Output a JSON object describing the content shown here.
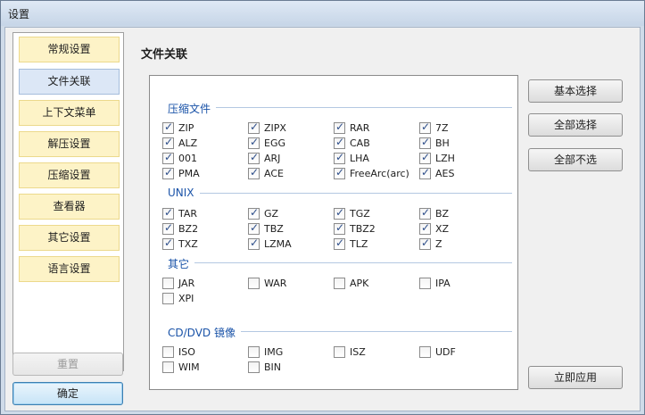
{
  "window": {
    "title": "设置"
  },
  "nav": {
    "items": [
      {
        "label": "常规设置",
        "active": false
      },
      {
        "label": "文件关联",
        "active": true
      },
      {
        "label": "上下文菜单",
        "active": false
      },
      {
        "label": "解压设置",
        "active": false
      },
      {
        "label": "压缩设置",
        "active": false
      },
      {
        "label": "查看器",
        "active": false
      },
      {
        "label": "其它设置",
        "active": false
      },
      {
        "label": "语言设置",
        "active": false
      }
    ],
    "reset_label": "重置",
    "ok_label": "确定"
  },
  "main": {
    "heading": "文件关联",
    "groups": [
      {
        "title": "压缩文件",
        "items": [
          {
            "label": "ZIP",
            "checked": true
          },
          {
            "label": "ZIPX",
            "checked": true
          },
          {
            "label": "RAR",
            "checked": true
          },
          {
            "label": "7Z",
            "checked": true
          },
          {
            "label": "ALZ",
            "checked": true
          },
          {
            "label": "EGG",
            "checked": true
          },
          {
            "label": "CAB",
            "checked": true
          },
          {
            "label": "BH",
            "checked": true
          },
          {
            "label": "001",
            "checked": true
          },
          {
            "label": "ARJ",
            "checked": true
          },
          {
            "label": "LHA",
            "checked": true
          },
          {
            "label": "LZH",
            "checked": true
          },
          {
            "label": "PMA",
            "checked": true
          },
          {
            "label": "ACE",
            "checked": true
          },
          {
            "label": "FreeArc(arc)",
            "checked": true
          },
          {
            "label": "AES",
            "checked": true
          }
        ]
      },
      {
        "title": "UNIX",
        "items": [
          {
            "label": "TAR",
            "checked": true
          },
          {
            "label": "GZ",
            "checked": true
          },
          {
            "label": "TGZ",
            "checked": true
          },
          {
            "label": "BZ",
            "checked": true
          },
          {
            "label": "BZ2",
            "checked": true
          },
          {
            "label": "TBZ",
            "checked": true
          },
          {
            "label": "TBZ2",
            "checked": true
          },
          {
            "label": "XZ",
            "checked": true
          },
          {
            "label": "TXZ",
            "checked": true
          },
          {
            "label": "LZMA",
            "checked": true
          },
          {
            "label": "TLZ",
            "checked": true
          },
          {
            "label": "Z",
            "checked": true
          }
        ]
      },
      {
        "title": "其它",
        "items": [
          {
            "label": "JAR",
            "checked": false
          },
          {
            "label": "WAR",
            "checked": false
          },
          {
            "label": "APK",
            "checked": false
          },
          {
            "label": "IPA",
            "checked": false
          },
          {
            "label": "XPI",
            "checked": false
          }
        ]
      },
      {
        "title": "CD/DVD 镜像",
        "items": [
          {
            "label": "ISO",
            "checked": false
          },
          {
            "label": "IMG",
            "checked": false
          },
          {
            "label": "ISZ",
            "checked": false
          },
          {
            "label": "UDF",
            "checked": false
          },
          {
            "label": "WIM",
            "checked": false
          },
          {
            "label": "BIN",
            "checked": false
          }
        ]
      }
    ]
  },
  "actions": {
    "basic_select": "基本选择",
    "select_all": "全部选择",
    "select_none": "全部不选",
    "apply_now": "立即应用"
  }
}
